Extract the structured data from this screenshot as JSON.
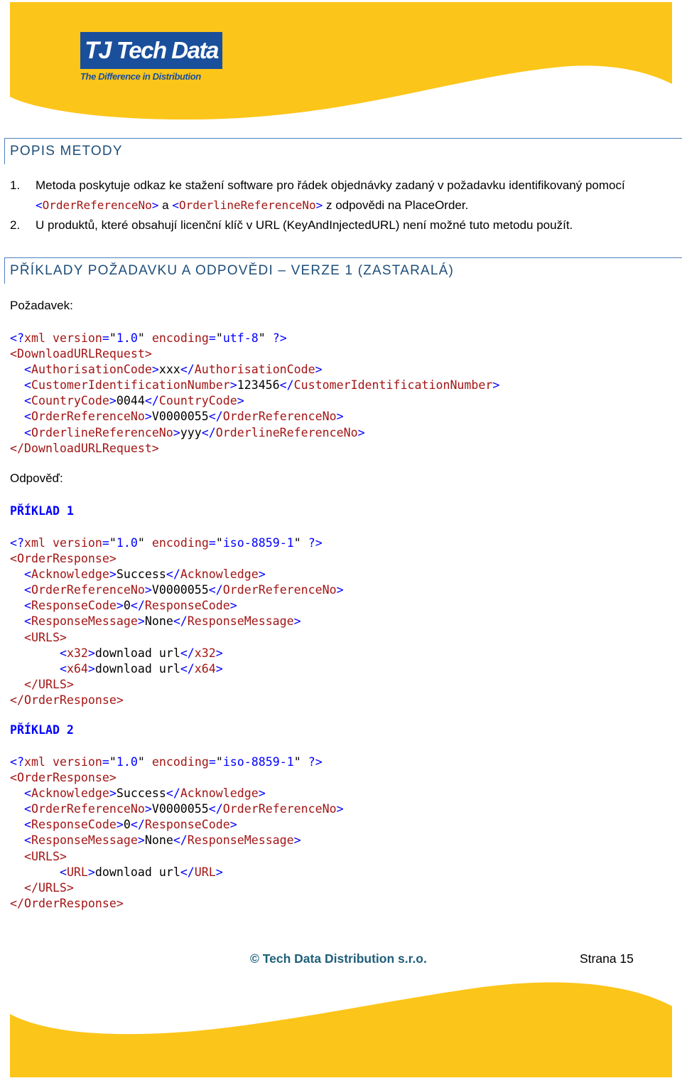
{
  "colors": {
    "brand_yellow": "#fcc51a",
    "brand_blue": "#1a4f9c",
    "heading": "#1f4e79",
    "xml_tag": "#a31515",
    "xml_punct": "#0000ff"
  },
  "header": {
    "logo_text": "Tech Data",
    "logo_tagline": "The Difference in Distribution"
  },
  "section1": {
    "title": "POPIS METODY",
    "items": [
      {
        "num": "1.",
        "before": "Metoda poskytuje odkaz ke stažení software pro řádek objednávky zadaný v požadavku identifikovaný pomocí ",
        "code1": "<OrderReferenceNo>",
        "mid": " a ",
        "code2": "<OrderlineReferenceNo>",
        "after": " z odpovědi na PlaceOrder."
      },
      {
        "num": "2.",
        "text": "U produktů, které obsahují licenční klíč v URL (KeyAndInjectedURL) není možné tuto metodu použít."
      }
    ]
  },
  "section2": {
    "title": "PŘÍKLADY POŽADAVKU A ODPOVĚDI – VERZE 1 (ZASTARALÁ)",
    "request_label": "Požadavek:",
    "request_code": [
      "<?xml version=\"1.0\" encoding=\"utf-8\" ?>",
      "<DownloadURLRequest>",
      "  <AuthorisationCode>xxx</AuthorisationCode>",
      "  <CustomerIdentificationNumber>123456</CustomerIdentificationNumber>",
      "  <CountryCode>0044</CountryCode>",
      "  <OrderReferenceNo>V0000055</OrderReferenceNo>",
      "  <OrderlineReferenceNo>yyy</OrderlineReferenceNo>",
      "</DownloadURLRequest>"
    ],
    "response_label": "Odpověď:",
    "example1_title": "PŘÍKLAD 1",
    "example1_code": [
      "<?xml version=\"1.0\" encoding=\"iso-8859-1\" ?>",
      "<OrderResponse>",
      "  <Acknowledge>Success</Acknowledge>",
      "  <OrderReferenceNo>V0000055</OrderReferenceNo>",
      "  <ResponseCode>0</ResponseCode>",
      "  <ResponseMessage>None</ResponseMessage>",
      "  <URLS>",
      "       <x32>download url</x32>",
      "       <x64>download url</x64>",
      "  </URLS>",
      "</OrderResponse>"
    ],
    "example2_title": "PŘÍKLAD 2",
    "example2_code": [
      "<?xml version=\"1.0\" encoding=\"iso-8859-1\" ?>",
      "<OrderResponse>",
      "  <Acknowledge>Success</Acknowledge>",
      "  <OrderReferenceNo>V0000055</OrderReferenceNo>",
      "  <ResponseCode>0</ResponseCode>",
      "  <ResponseMessage>None</ResponseMessage>",
      "  <URLS>",
      "       <URL>download url</URL>",
      "  </URLS>",
      "</OrderResponse>"
    ]
  },
  "footer": {
    "copyright": "© Tech Data Distribution s.r.o.",
    "page": "Strana 15"
  }
}
